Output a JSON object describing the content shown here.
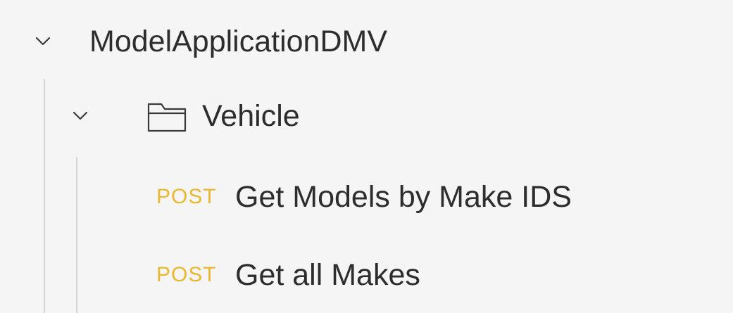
{
  "collection": {
    "name": "ModelApplicationDMV",
    "expanded": true,
    "icon": "chevron-down-icon"
  },
  "folder": {
    "name": "Vehicle",
    "expanded": true,
    "icons": [
      "chevron-down-icon",
      "folder-icon"
    ]
  },
  "requests": [
    {
      "method": "POST",
      "name": "Get Models by Make IDS"
    },
    {
      "method": "POST",
      "name": "Get all Makes"
    }
  ],
  "colors": {
    "background": "#f5f5f5",
    "text": "#2d2d2d",
    "method_post": "#e8b830",
    "guide_line": "#d4d4d4"
  }
}
